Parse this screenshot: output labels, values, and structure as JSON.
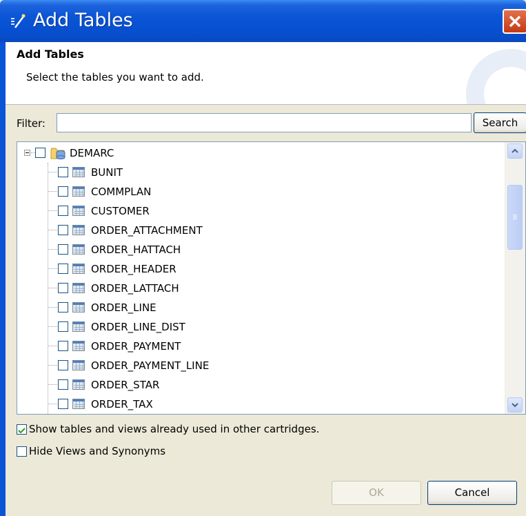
{
  "window": {
    "title": "Add Tables",
    "icon": "wizard-wand-icon",
    "close_icon": "close-icon",
    "close_color": "#d4491f",
    "titlebar_color": "#0a55d6"
  },
  "header": {
    "title": "Add Tables",
    "description": "Select the tables you want to add."
  },
  "filter": {
    "label": "Filter:",
    "value": "",
    "search_button": "Search"
  },
  "tree": {
    "root": {
      "label": "DEMARC",
      "icon": "database-folder-icon",
      "expanded": true,
      "checked": false
    },
    "items": [
      {
        "label": "BUNIT",
        "checked": false
      },
      {
        "label": "COMMPLAN",
        "checked": false
      },
      {
        "label": "CUSTOMER",
        "checked": false
      },
      {
        "label": "ORDER_ATTACHMENT",
        "checked": false
      },
      {
        "label": "ORDER_HATTACH",
        "checked": false
      },
      {
        "label": "ORDER_HEADER",
        "checked": false
      },
      {
        "label": "ORDER_LATTACH",
        "checked": false
      },
      {
        "label": "ORDER_LINE",
        "checked": false
      },
      {
        "label": "ORDER_LINE_DIST",
        "checked": false
      },
      {
        "label": "ORDER_PAYMENT",
        "checked": false
      },
      {
        "label": "ORDER_PAYMENT_LINE",
        "checked": false
      },
      {
        "label": "ORDER_STAR",
        "checked": false
      },
      {
        "label": "ORDER_TAX",
        "checked": false
      }
    ],
    "item_icon": "table-icon"
  },
  "options": {
    "show_used": {
      "label": "Show tables and views already used in other cartridges.",
      "checked": true
    },
    "hide_views": {
      "label": "Hide Views and Synonyms",
      "checked": false
    }
  },
  "buttons": {
    "ok": "OK",
    "ok_enabled": false,
    "cancel": "Cancel"
  }
}
